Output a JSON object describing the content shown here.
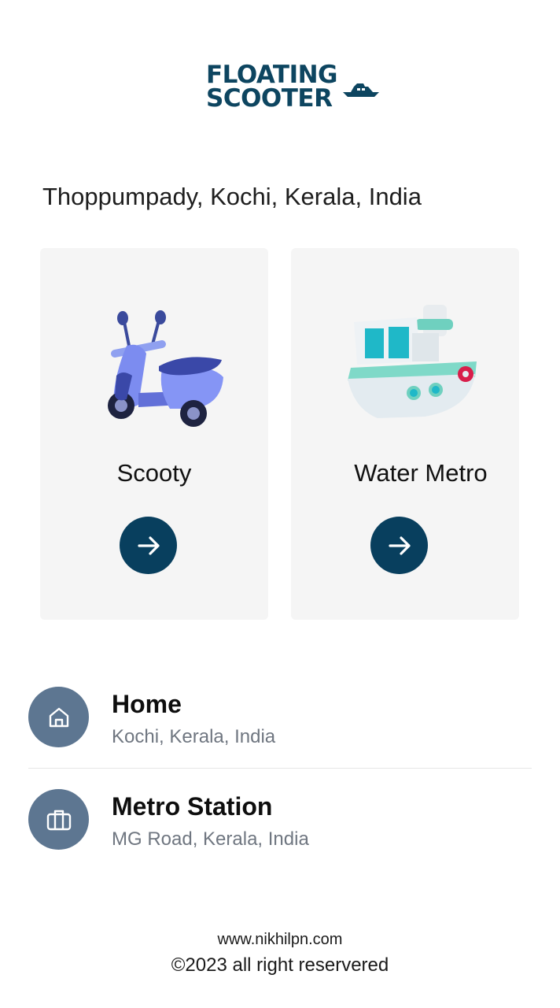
{
  "logo": {
    "line1": "FLOATING",
    "line2": "SCOOTER",
    "icon": "boat-icon",
    "color": "#0d4560"
  },
  "location": {
    "text": "Thoppumpady, Kochi, Kerala, India"
  },
  "options": [
    {
      "label": "Scooty",
      "illustration": "scooter-illustration",
      "action_icon": "arrow-right-icon"
    },
    {
      "label": "Water Metro",
      "illustration": "boat-illustration",
      "action_icon": "arrow-right-icon"
    }
  ],
  "saved_places": [
    {
      "title": "Home",
      "subtitle": "Kochi, Kerala, India",
      "icon": "home-icon"
    },
    {
      "title": "Metro Station",
      "subtitle": "MG Road, Kerala, India",
      "icon": "briefcase-icon"
    }
  ],
  "footer": {
    "website": "www.nikhilpn.com",
    "copyright": "©2023 all right reservered"
  },
  "colors": {
    "accent": "#083f5e",
    "avatar_bg": "#5d7691",
    "card_bg": "#f5f5f5"
  }
}
